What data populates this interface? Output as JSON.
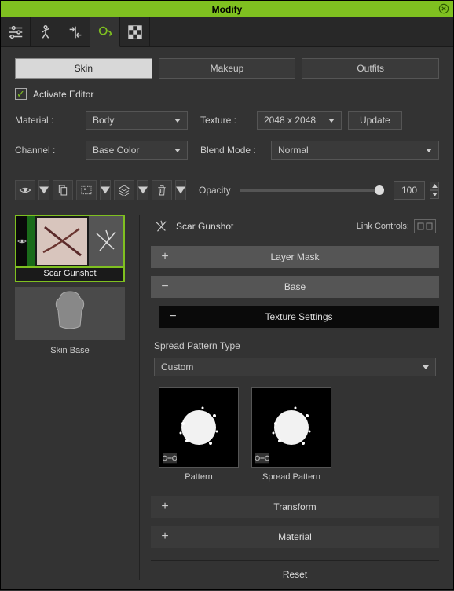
{
  "title": "Modify",
  "tabs": {
    "skin": "Skin",
    "makeup": "Makeup",
    "outfits": "Outfits"
  },
  "activate": "Activate Editor",
  "material_label": "Material :",
  "material_value": "Body",
  "texture_label": "Texture :",
  "texture_value": "2048 x 2048",
  "update": "Update",
  "channel_label": "Channel :",
  "channel_value": "Base Color",
  "blend_label": "Blend Mode :",
  "blend_value": "Normal",
  "opacity_label": "Opacity",
  "opacity_value": "100",
  "layers": [
    {
      "name": "Scar Gunshot"
    },
    {
      "name": "Skin Base"
    }
  ],
  "details_title": "Scar Gunshot",
  "link_controls_label": "Link Controls:",
  "sections": {
    "layer_mask": "Layer Mask",
    "base": "Base",
    "texture_settings": "Texture Settings",
    "transform": "Transform",
    "material": "Material"
  },
  "spread_type_label": "Spread Pattern Type",
  "spread_type_value": "Custom",
  "pattern_labels": {
    "pattern": "Pattern",
    "spread": "Spread Pattern"
  },
  "reset": "Reset"
}
